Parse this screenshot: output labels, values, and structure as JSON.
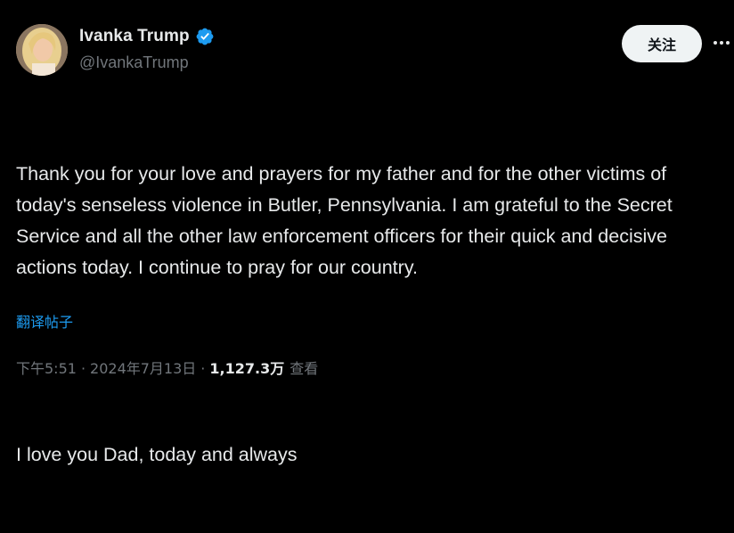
{
  "author": {
    "display_name": "Ivanka Trump",
    "handle": "@IvankaTrump",
    "verified": true,
    "verified_color": "#1d9bf0",
    "avatar_icon": "profile-photo"
  },
  "actions": {
    "follow_label": "关注",
    "more_icon": "more-horizontal-icon"
  },
  "tweet": {
    "paragraph_1": "Thank you for your love and prayers for my father and for the other victims of today's senseless violence in Butler, Pennsylvania. I am grateful to the Secret Service and all the other law enforcement officers for their quick and decisive actions today. I continue to pray for our country.",
    "paragraph_2": "I love you Dad, today and always"
  },
  "translate_label": "翻译帖子",
  "meta": {
    "time": "下午5:51",
    "separator": "·",
    "date": "2024年7月13日",
    "views_count": "1,127.3万",
    "views_label": "查看"
  },
  "colors": {
    "background": "#000000",
    "text": "#e7e9ea",
    "muted": "#71767b",
    "link": "#1d9bf0",
    "button_bg": "#eff3f4"
  }
}
